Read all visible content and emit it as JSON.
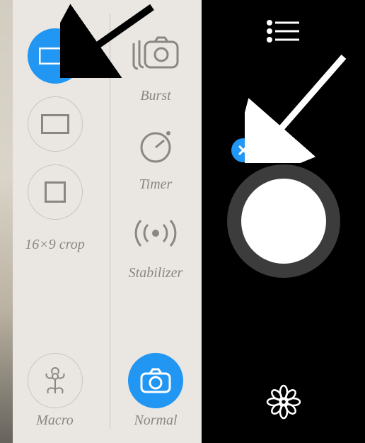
{
  "colors": {
    "accent": "#2196f3",
    "panel_bg": "#eae7e2",
    "muted": "#8a8782"
  },
  "left": {
    "column_a": [
      {
        "id": "aspect-wide",
        "icon": "wide-rect",
        "label": "",
        "active": true
      },
      {
        "id": "aspect-43",
        "icon": "rect-43",
        "label": "",
        "active": false
      },
      {
        "id": "aspect-sq",
        "icon": "square",
        "label": "",
        "active": false
      },
      {
        "id": "aspect-169",
        "icon": "",
        "label": "16×9 crop",
        "active": false,
        "textOnly": true
      },
      {
        "id": "macro-mode",
        "icon": "flower",
        "label": "Macro",
        "active": false
      }
    ],
    "column_b": [
      {
        "id": "burst-mode",
        "icon": "burst-stack",
        "label": "Burst",
        "active": false,
        "noCircle": true
      },
      {
        "id": "timer-mode",
        "icon": "timer",
        "label": "Timer",
        "active": false,
        "noCircle": true
      },
      {
        "id": "stabilizer-mode",
        "icon": "stabilizer",
        "label": "Stabilizer",
        "active": false,
        "noCircle": true
      },
      {
        "id": "normal-mode",
        "icon": "camera",
        "label": "Normal",
        "active": true
      }
    ]
  },
  "right": {
    "menu_icon": "list",
    "close_icon": "close",
    "shutter": "shutter",
    "gallery_icon": "flower"
  }
}
